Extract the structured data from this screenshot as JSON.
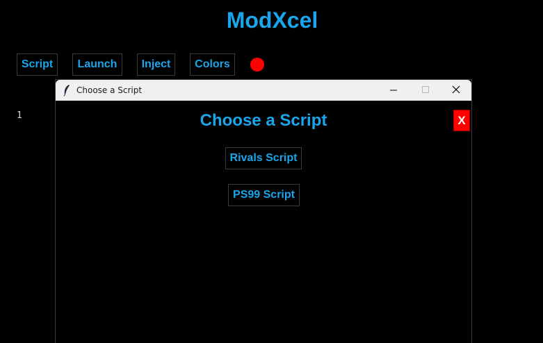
{
  "app": {
    "title": "ModXcel"
  },
  "toolbar": {
    "buttons": [
      {
        "label": "Script"
      },
      {
        "label": "Launch"
      },
      {
        "label": "Inject"
      },
      {
        "label": "Colors"
      }
    ],
    "status_color": "#ff0000"
  },
  "editor": {
    "line_number": "1"
  },
  "dialog": {
    "window_title": "Choose a Script",
    "heading": "Choose a Script",
    "close_label": "X",
    "options": [
      {
        "label": "Rivals Script"
      },
      {
        "label": "PS99 Script"
      }
    ]
  },
  "colors": {
    "accent": "#1aa6ec",
    "background": "#000000",
    "danger": "#ff0000"
  }
}
